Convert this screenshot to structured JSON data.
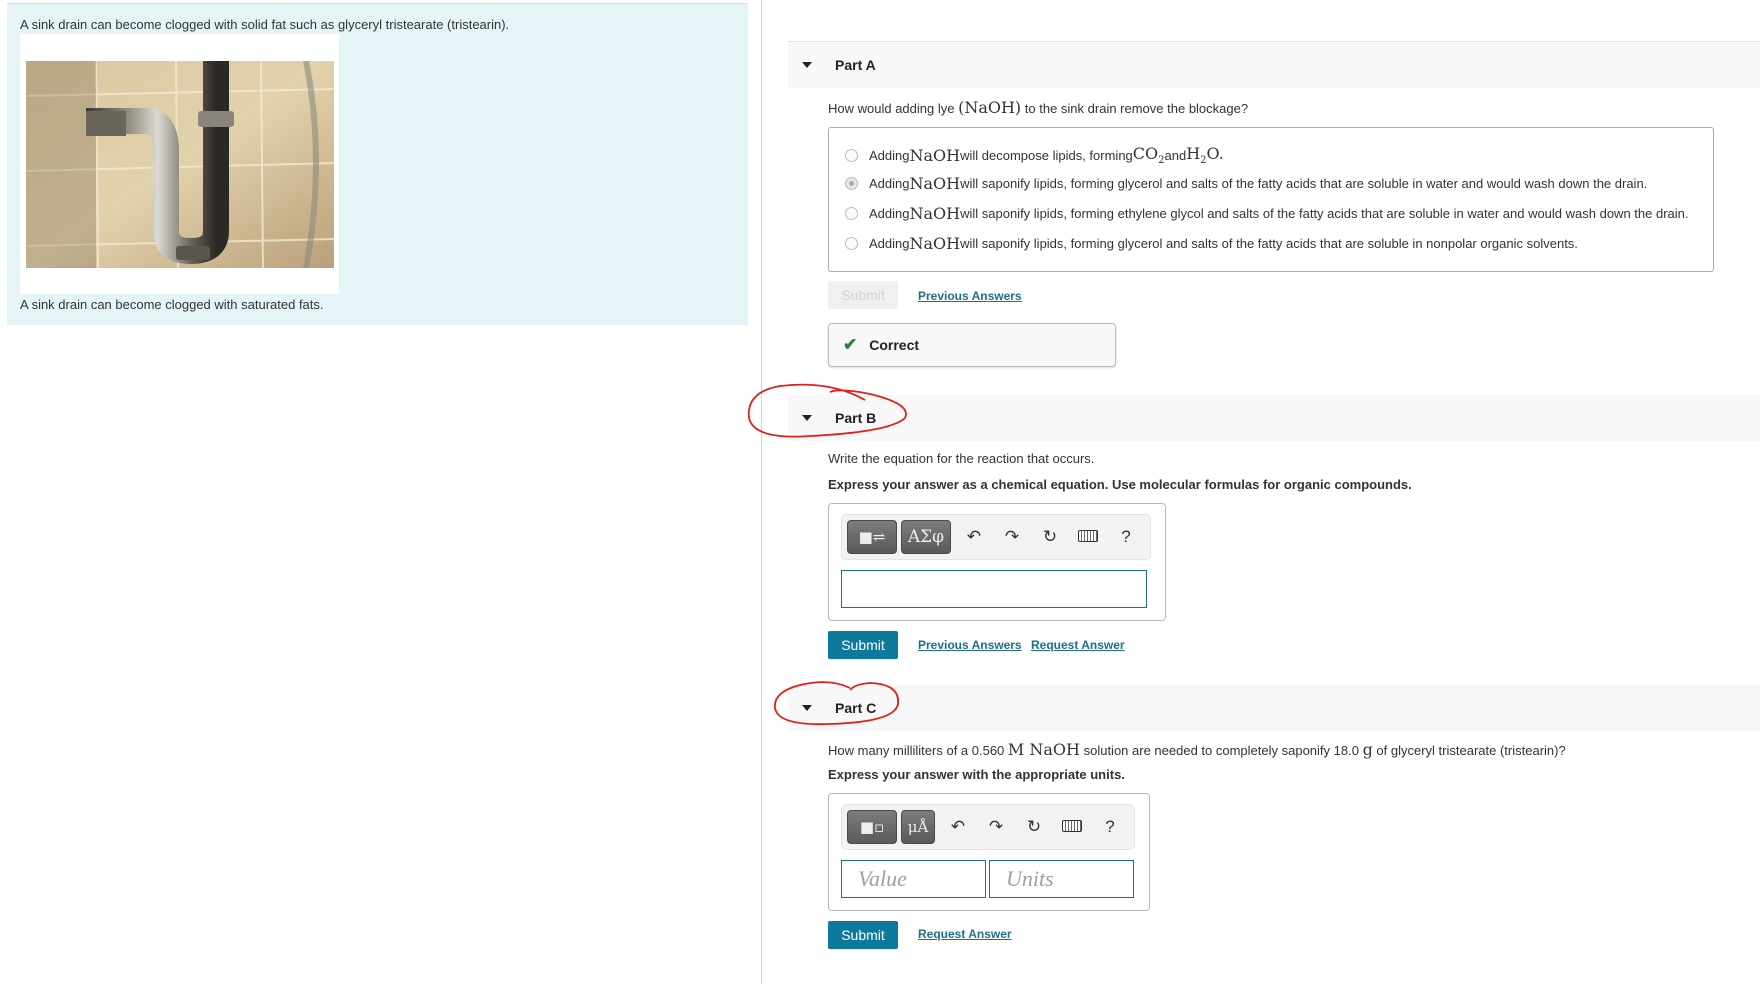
{
  "intro": {
    "text": "A sink drain can become clogged with solid fat such as glyceryl tristearate (tristearin).",
    "image_alt": "Chrome P-trap sink drain pipe against tiled wall",
    "caption": "A sink drain can become clogged with saturated fats."
  },
  "partA": {
    "title": "Part A",
    "question_pre": "How would adding lye ",
    "question_math": "(NaOH)",
    "question_post": " to the sink drain remove the blockage?",
    "choices": [
      {
        "pre": "Adding ",
        "math": "NaOH",
        "text": " will decompose lipids, forming CO₂ and H₂O.",
        "selected": false
      },
      {
        "pre": "Adding ",
        "math": "NaOH",
        "text": " will saponify lipids, forming glycerol and salts of the fatty acids that are soluble in water and would wash down the drain.",
        "selected": true
      },
      {
        "pre": "Adding ",
        "math": "NaOH",
        "text": " will saponify lipids, forming ethylene glycol and salts of the fatty acids that are soluble in water and would wash down the drain.",
        "selected": false
      },
      {
        "pre": "Adding ",
        "math": "NaOH",
        "text": " will saponify lipids, forming glycerol and salts of the fatty acids that are soluble in nonpolar organic solvents.",
        "selected": false
      }
    ],
    "choice0_a": " will decompose lipids, forming ",
    "choice0_co2": "CO",
    "choice0_and": " and ",
    "choice0_h2o_h": "H",
    "choice0_h2o_o": "O.",
    "sub2": "2",
    "submit_label": "Submit",
    "previous_answers_label": "Previous Answers",
    "feedback": "Correct"
  },
  "partB": {
    "title": "Part B",
    "question": "Write the equation for the reaction that occurs.",
    "instruction": "Express your answer as a chemical equation. Use molecular formulas for organic compounds.",
    "toolbar": {
      "template_btn": "■⇌",
      "greek_btn": "ΑΣφ",
      "undo": "↶",
      "redo": "↷",
      "reset": "↻",
      "help": "?"
    },
    "answer_value": "",
    "submit_label": "Submit",
    "previous_answers_label": "Previous Answers",
    "request_answer_label": "Request Answer"
  },
  "partC": {
    "title": "Part C",
    "question_pre": "How many milliliters of a 0.560 ",
    "question_math": "M NaOH",
    "question_mid": " solution are needed to completely saponify 18.0 ",
    "question_unit": "g",
    "question_post": " of glyceryl tristearate (tristearin)?",
    "instruction": "Express your answer with the appropriate units.",
    "toolbar": {
      "template_btn": "■▫",
      "units_btn": "μÅ",
      "undo": "↶",
      "redo": "↷",
      "reset": "↻",
      "help": "?"
    },
    "value_placeholder": "Value",
    "units_placeholder": "Units",
    "submit_label": "Submit",
    "request_answer_label": "Request Answer"
  },
  "colors": {
    "accent": "#0d7a9b",
    "link": "#1d6f8c",
    "correct": "#1a8a3a",
    "intro_bg": "#e5f5f7",
    "annotation": "#e0201a"
  }
}
